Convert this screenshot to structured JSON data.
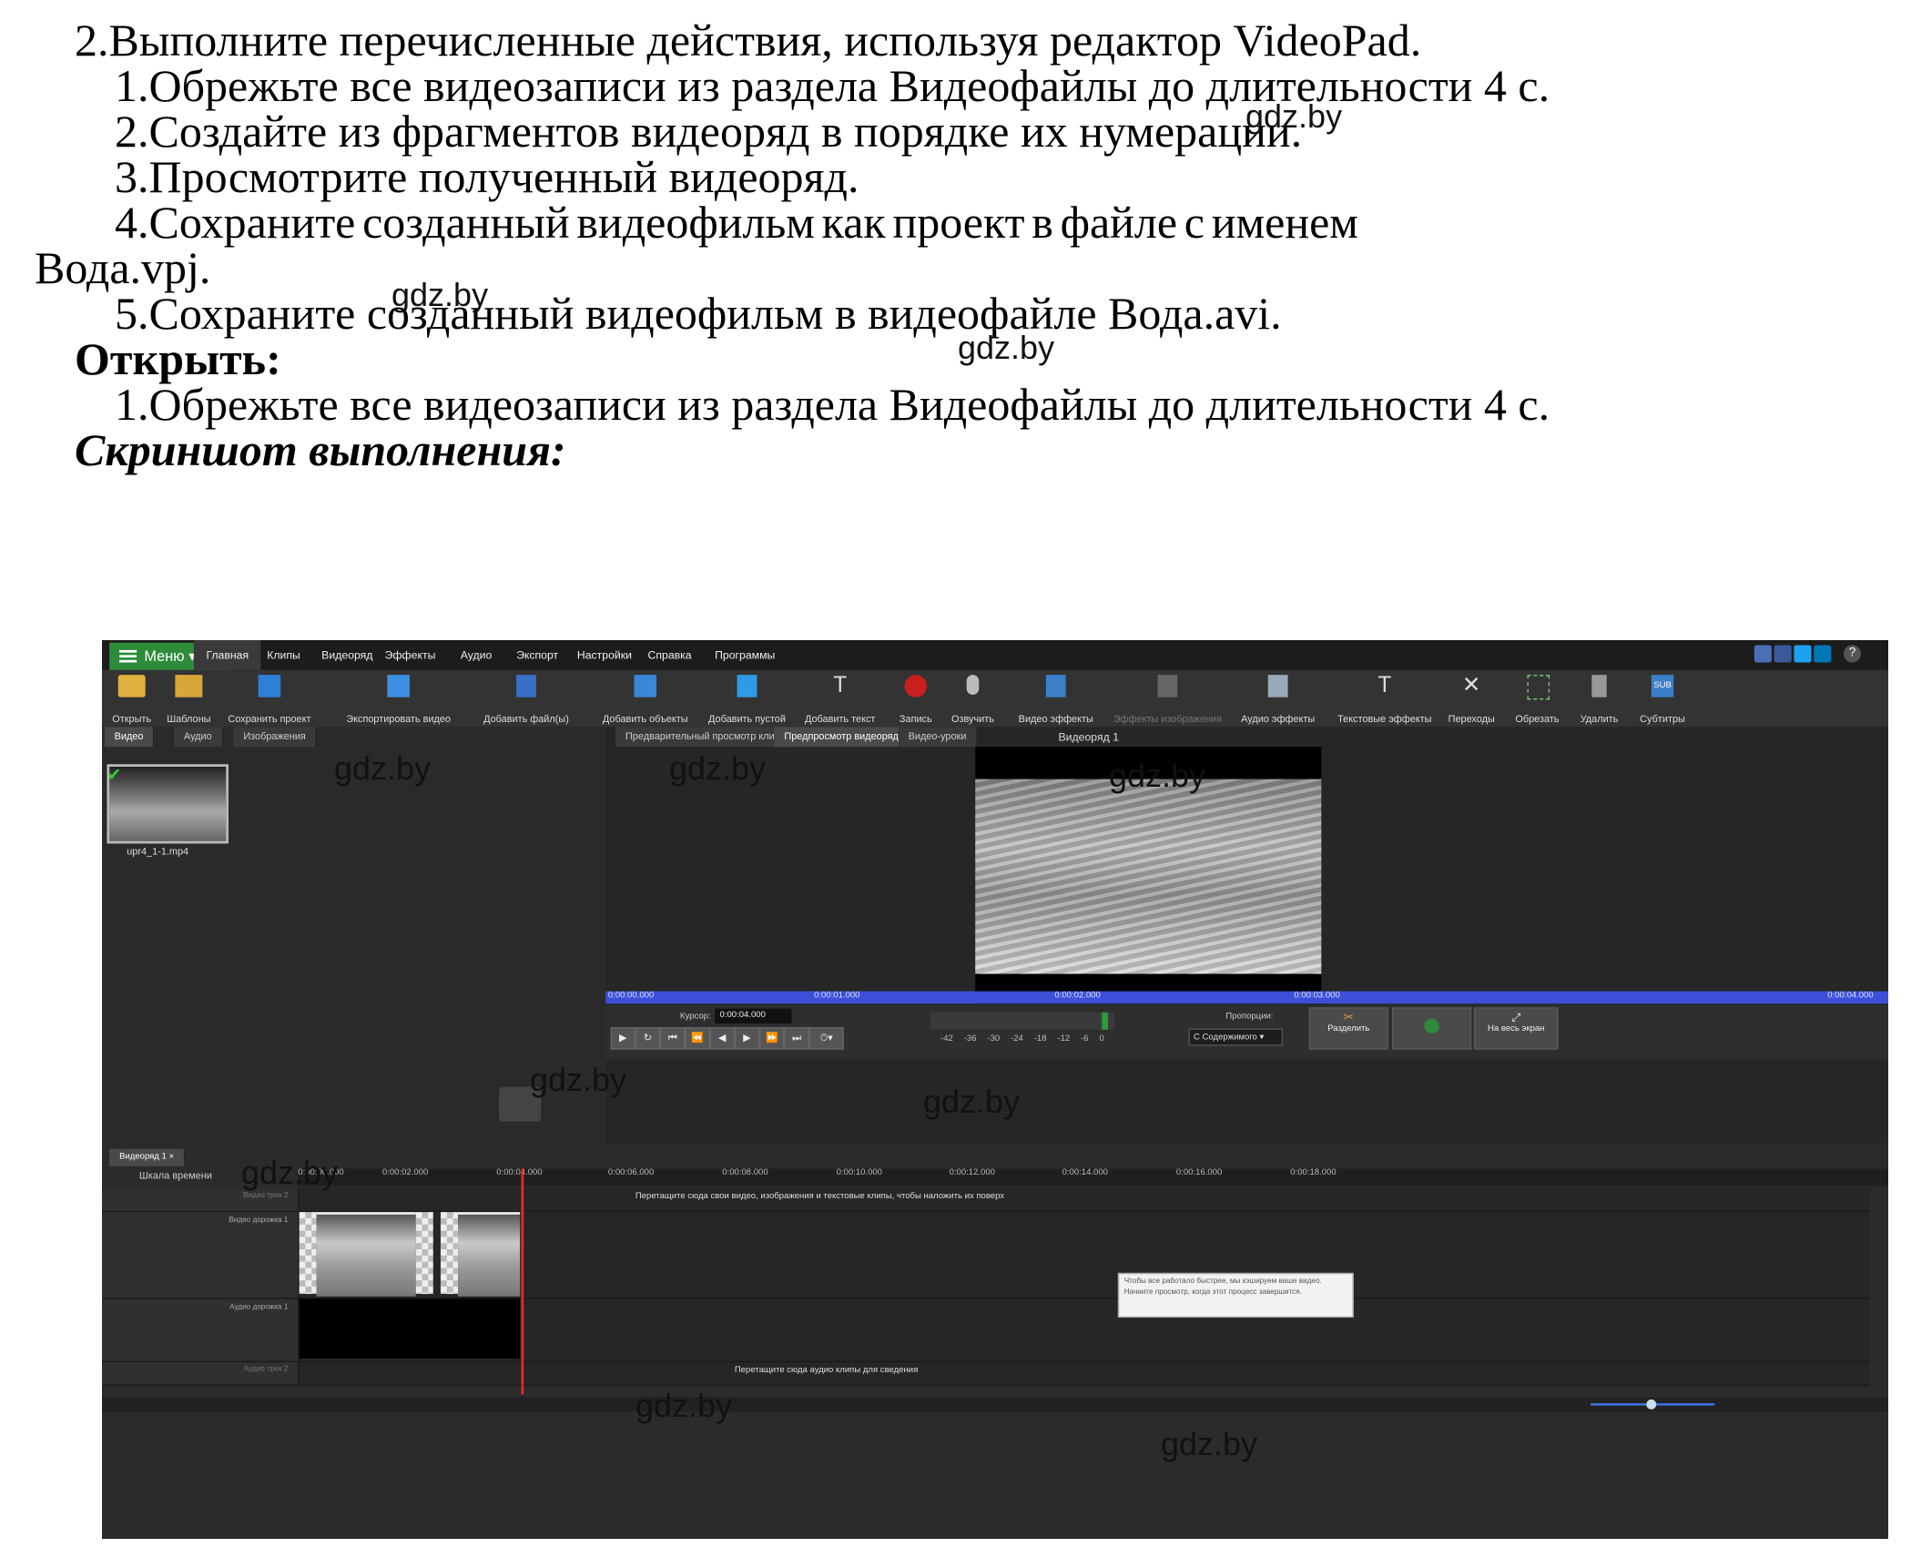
{
  "document": {
    "heading": "2.Выполните перечисленные действия, используя редактор VideoPad.",
    "task1": "1.Обрежьте все видеозаписи из раздела Видеофайлы до длительности 4 с.",
    "task2": "2.Создайте из фрагментов видеоряд в порядке их нумерации.",
    "task3": "3.Просмотрите полученный видеоряд.",
    "task4_words": [
      "4.Сохраните",
      "созданный",
      "видеофильм",
      "как",
      "проект",
      "в",
      "файле",
      "с",
      "именем"
    ],
    "task4_cont": "Вода.vpj.",
    "task5": "5.Сохраните созданный видеофильм в видеофайле Вода.avi.",
    "open_label": "Открыть:",
    "open_task1": "1.Обрежьте все видеозаписи из раздела Видеофайлы до длительности 4 с.",
    "screenshot_label": "Скриншот выполнения:"
  },
  "watermark": "gdz.by",
  "app": {
    "menu_button": "Меню",
    "menu": [
      "Главная",
      "Клипы",
      "Видеоряд",
      "Эффекты",
      "Аудио",
      "Экспорт",
      "Настройки",
      "Справка",
      "Программы"
    ],
    "toolbar": [
      {
        "label": "Открыть",
        "icon": "folder-open-icon"
      },
      {
        "label": "Шаблоны",
        "icon": "templates-icon"
      },
      {
        "label": "Сохранить проект",
        "icon": "save-icon"
      },
      {
        "label": "Экспортировать видео",
        "icon": "export-icon"
      },
      {
        "label": "Добавить файл(ы)",
        "icon": "add-file-icon"
      },
      {
        "label": "Добавить объекты",
        "icon": "add-objects-icon"
      },
      {
        "label": "Добавить пустой",
        "icon": "add-blank-icon"
      },
      {
        "label": "Добавить текст",
        "icon": "add-text-icon"
      },
      {
        "label": "Запись",
        "icon": "record-icon"
      },
      {
        "label": "Озвучить",
        "icon": "microphone-icon"
      },
      {
        "label": "Видео эффекты",
        "icon": "video-effects-icon"
      },
      {
        "label": "Эффекты изображения",
        "icon": "image-effects-icon"
      },
      {
        "label": "Аудио эффекты",
        "icon": "audio-effects-icon"
      },
      {
        "label": "Текстовые эффекты",
        "icon": "text-effects-icon"
      },
      {
        "label": "Переходы",
        "icon": "transitions-icon"
      },
      {
        "label": "Обрезать",
        "icon": "crop-icon"
      },
      {
        "label": "Удалить",
        "icon": "trash-icon"
      },
      {
        "label": "Субтитры",
        "icon": "subtitles-icon"
      }
    ],
    "bin_tabs": [
      "Видео",
      "Аудио",
      "Изображения"
    ],
    "clip_name": "upr4_1-1.mp4",
    "preview_tabs": [
      "Предварительный просмотр клипа",
      "Предпросмотр видеоряда",
      "Видео-уроки"
    ],
    "preview_title": "Видеоряд 1",
    "scrub_times": [
      "0:00:00.000",
      "0:00:01.000",
      "0:00:02.000",
      "0:00:03.000",
      "0:00:04.000"
    ],
    "cursor_label": "Курсор:",
    "cursor_value": "0:00:04.000",
    "meter_ticks": [
      "-42",
      "-36",
      "-30",
      "-24",
      "-18",
      "-12",
      "-6",
      "0"
    ],
    "proportions_label": "Пропорции:",
    "proportions_value": "С Содержимого",
    "split_button": "Разделить",
    "fullscreen_button": "На весь экран",
    "timeline_tab": "Видеоряд 1",
    "timeline_scale": "Шкала времени",
    "ruler_times": [
      "0:00:00.000",
      "0:00:02.000",
      "0:00:04.000",
      "0:00:06.000",
      "0:00:08.000",
      "0:00:10.000",
      "0:00:12.000",
      "0:00:14.000",
      "0:00:16.000",
      "0:00:18.000"
    ],
    "track_video2": "Видео трек 2",
    "track_video1": "Видео дорожка 1",
    "track_audio1": "Аудио дорожка 1",
    "track_audio2": "Аудио трек 2",
    "hint_video": "Перетащите сюда свои видео, изображения и текстовые клипы, чтобы наложить их поверх",
    "hint_audio": "Перетащите сюда аудио клипы для сведения",
    "tooltip": "Чтобы все работало быстрее, мы кэшируем ваше видео. Начните просмотр, когда этот процесс завершится."
  }
}
